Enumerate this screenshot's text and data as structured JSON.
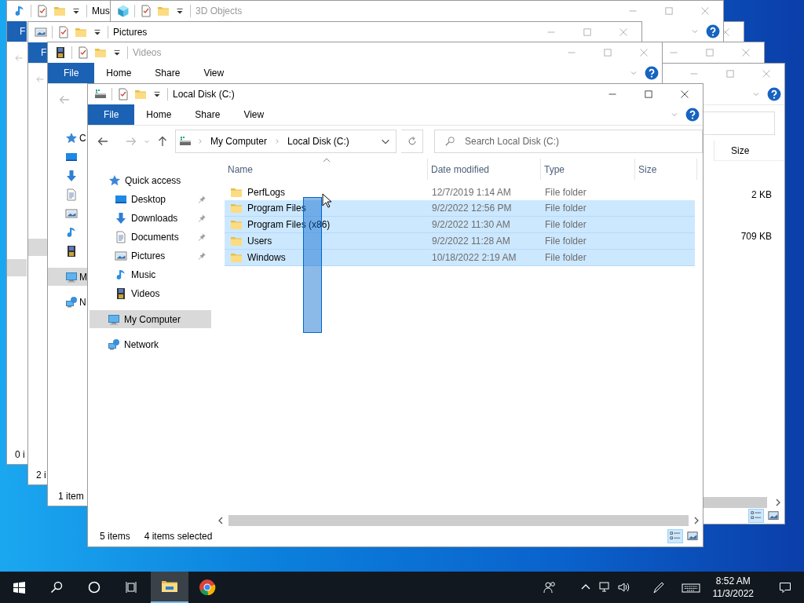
{
  "music_window": {
    "title": "Mus",
    "file_tab": "F",
    "status": "0 i"
  },
  "objects_window": {
    "title": "3D Objects"
  },
  "pictures_window": {
    "title": "Pictures",
    "file_tab": "F",
    "status": "2 i"
  },
  "size_window": {
    "columns": [
      "Size"
    ],
    "rows": [
      "2 KB",
      "709 KB"
    ]
  },
  "videos_window": {
    "title": "Videos",
    "tabs": [
      {
        "label": "File",
        "selected": true
      },
      {
        "label": "Home",
        "selected": false
      },
      {
        "label": "Share",
        "selected": false
      },
      {
        "label": "View",
        "selected": false
      }
    ],
    "sidebar": [
      {
        "label": "C",
        "kind": "star",
        "selected": false
      },
      {
        "kind": "desktop",
        "selected": false
      },
      {
        "kind": "download",
        "selected": false
      },
      {
        "kind": "document",
        "selected": false
      },
      {
        "kind": "image",
        "selected": false
      },
      {
        "kind": "music",
        "selected": false
      },
      {
        "kind": "film",
        "selected": false
      },
      {
        "label": "M",
        "kind": "computer",
        "selected": true
      },
      {
        "label": "N",
        "kind": "network",
        "selected": false
      }
    ],
    "status": "1 item"
  },
  "explorer": {
    "title": "Local Disk (C:)",
    "tabs": [
      {
        "label": "File",
        "selected": true
      },
      {
        "label": "Home",
        "selected": false
      },
      {
        "label": "Share",
        "selected": false
      },
      {
        "label": "View",
        "selected": false
      }
    ],
    "address": [
      "My Computer",
      "Local Disk (C:)"
    ],
    "search": {
      "placeholder": "Search Local Disk (C:)"
    },
    "sidebar": [
      {
        "label": "Quick access",
        "kind": "star",
        "selected": false,
        "children": [
          {
            "label": "Desktop",
            "kind": "desktop",
            "pinned": true,
            "selected": false
          },
          {
            "label": "Downloads",
            "kind": "download",
            "pinned": true,
            "selected": false
          },
          {
            "label": "Documents",
            "kind": "document",
            "pinned": true,
            "selected": false
          },
          {
            "label": "Pictures",
            "kind": "image",
            "pinned": true,
            "selected": false
          },
          {
            "label": "Music",
            "kind": "music",
            "pinned": false,
            "selected": false
          },
          {
            "label": "Videos",
            "kind": "film",
            "pinned": false,
            "selected": false
          }
        ]
      },
      {
        "label": "My Computer",
        "kind": "computer",
        "selected": true
      },
      {
        "label": "Network",
        "kind": "network",
        "selected": false
      }
    ],
    "columns": [
      "Name",
      "Date modified",
      "Type",
      "Size"
    ],
    "rows": [
      {
        "name": "PerfLogs",
        "date": "12/7/2019 1:14 AM",
        "type": "File folder",
        "selected": false
      },
      {
        "name": "Program Files",
        "date": "9/2/2022 12:56 PM",
        "type": "File folder",
        "selected": true
      },
      {
        "name": "Program Files (x86)",
        "date": "9/2/2022 11:30 AM",
        "type": "File folder",
        "selected": true
      },
      {
        "name": "Users",
        "date": "9/2/2022 11:28 AM",
        "type": "File folder",
        "selected": true
      },
      {
        "name": "Windows",
        "date": "10/18/2022 2:19 AM",
        "type": "File folder",
        "selected": true
      }
    ],
    "status": {
      "count": "5 items",
      "selection": "4 items selected"
    }
  },
  "taskbar": {
    "apps": [
      {
        "kind": "explorer",
        "selected": true
      },
      {
        "kind": "chrome",
        "selected": false
      }
    ],
    "time": "8:52 AM",
    "date": "11/3/2022"
  }
}
